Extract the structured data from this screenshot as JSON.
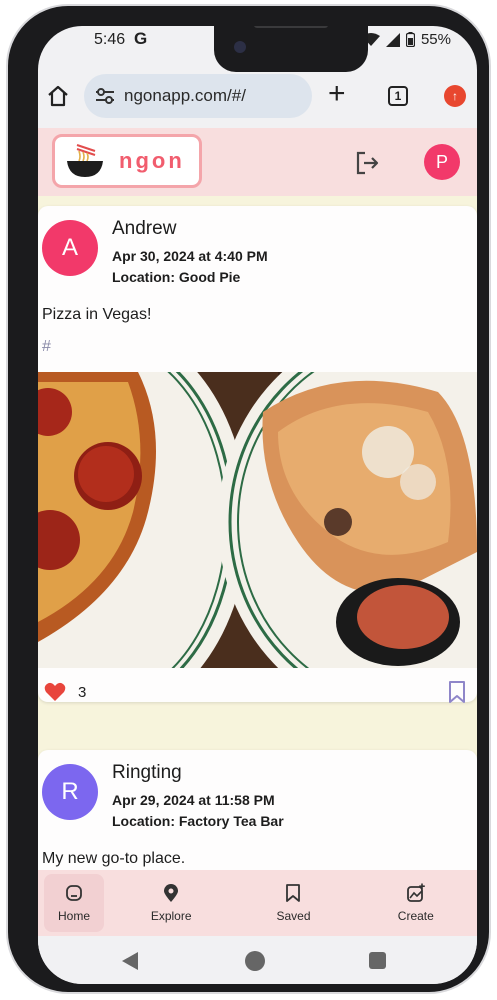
{
  "status_bar": {
    "time": "5:46",
    "g_label": "G",
    "battery": "55%"
  },
  "browser": {
    "url": "ngonapp.com/#/",
    "tab_count": "1",
    "new_tab_label": "+"
  },
  "app_header": {
    "logo_text": "ngon",
    "user_initial": "P"
  },
  "posts": [
    {
      "initial": "A",
      "avatar_color": "#f2396a",
      "author": "Andrew",
      "date": "Apr 30, 2024 at 4:40 PM",
      "location": "Location: Good Pie",
      "caption": "Pizza in Vegas!",
      "hashtag": "#",
      "likes": "3"
    },
    {
      "initial": "R",
      "avatar_color": "#7c67ef",
      "author": "Ringting",
      "date": "Apr 29, 2024 at 11:58 PM",
      "location": "Location: Factory Tea Bar",
      "caption": "My new go-to place."
    }
  ],
  "bottom_nav": {
    "items": [
      {
        "label": "Home",
        "icon": "home-icon"
      },
      {
        "label": "Explore",
        "icon": "explore-icon"
      },
      {
        "label": "Saved",
        "icon": "bookmark-icon"
      },
      {
        "label": "Create",
        "icon": "create-icon"
      }
    ]
  },
  "colors": {
    "accent": "#f2396a",
    "header_bg": "#f8dede",
    "feed_bg": "#f7f4dc",
    "like": "#e8453c",
    "bookmark": "#8f86c9"
  }
}
